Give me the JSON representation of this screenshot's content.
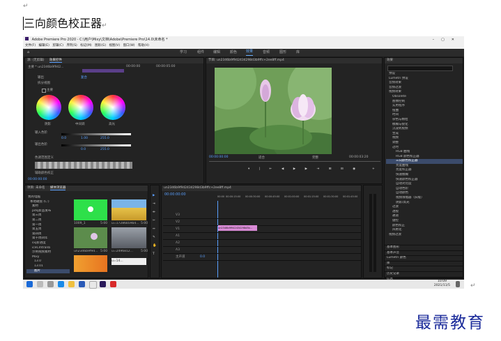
{
  "doc": {
    "title": "三向颜色校正器",
    "return_mark": "↵"
  },
  "app": {
    "window_title": "Adobe Premiere Pro 2020 - C:\\用户\\Mixy\\文档\\Adobe\\Premiere Pro\\14.0\\未命名 *",
    "menus": [
      "文件(F)",
      "编辑(E)",
      "剪辑(C)",
      "序列(S)",
      "标记(M)",
      "图形(G)",
      "视图(V)",
      "窗口(W)",
      "帮助(H)"
    ],
    "workspaces": [
      "学习",
      "组件",
      "编辑",
      "颜色",
      "效果",
      "音频",
      "图形",
      "库"
    ],
    "active_workspace": "效果",
    "window_controls": [
      "–",
      "▢",
      "✕"
    ]
  },
  "effect_controls": {
    "tabs": [
      "源: (无剪辑)",
      "效果控件"
    ],
    "clip": "主要 * un2346b9f942...",
    "time_start": "00:00:00",
    "time_end": "00:00:05:00",
    "output_label": "输出",
    "output_value": "复合",
    "bypass_label": "拆分视图",
    "master_label": "主要",
    "wheels": [
      {
        "label": "阴影"
      },
      {
        "label": "中间调"
      },
      {
        "label": "高光"
      }
    ],
    "input_levels_label": "输入色阶",
    "input_levels_values": [
      "0.0",
      "1.00",
      "255.0"
    ],
    "output_levels_label": "输出色阶",
    "output_levels_values": [
      "0.0",
      "255.0"
    ],
    "tonal_range_label": "色调范围定义",
    "secondary_label": "辅助颜色校正",
    "timecode": "00:00:00:00"
  },
  "program": {
    "title": "节目: un2346b9f942434298d3b9ffc+2ee8ff.mp4",
    "timecode_left": "00:00:00:00",
    "fit": "适合",
    "quality": "完整",
    "timecode_right": "00:00:03:20"
  },
  "project": {
    "tabs": [
      "项目: 未命名",
      "媒体浏览器"
    ],
    "tree": [
      "我的电脑",
      "本地磁盘 (C:)",
      "素材",
      "pdsj新品发布",
      "第三周",
      "第二周",
      "第一周",
      "第五周",
      "第四周",
      "第十周四年",
      "sxj新进度",
      "iceCmtranb",
      "示例视频素材",
      "Mixy",
      "13.0",
      "13.01",
      "图片"
    ],
    "thumbs": [
      {
        "name": "1009_1",
        "dur": "5:00"
      },
      {
        "name": "u=17286b59b4...",
        "dur": "5:00"
      },
      {
        "name": "un2346b9f94...",
        "dur": "5:00"
      },
      {
        "name": "u=2496812...",
        "dur": "5:00"
      },
      {
        "name": "u=14...",
        "dur": ""
      }
    ]
  },
  "timeline": {
    "title": "un2346b9f942434298d3b9ffc+2ee8ff.mp4",
    "timecode": "00:00:00:00",
    "ruler": [
      "00:00",
      "00:00:15:00",
      "00:00:30:00",
      "00:00:45:00",
      "00:01:00:00",
      "00:01:15:00",
      "00:01:30:00",
      "00:01:45:00"
    ],
    "tracks": [
      "V3",
      "V2",
      "V1",
      "A1",
      "A2",
      "A3",
      "主声道"
    ],
    "master_value": "0.0",
    "clip_label": "un2346b9f942434298d3b..."
  },
  "effects": {
    "title": "效果",
    "tree": [
      "预设",
      "Lumetri 预设",
      "音频效果",
      "音频过渡",
      "视频效果",
      "Obsolete",
      "图像控制",
      "实用程序",
      "扭曲",
      "时间",
      "杂色与颗粒",
      "模糊与锐化",
      "沉浸式视频",
      "生成",
      "视频",
      "调整",
      "过时",
      "RGB 曲线",
      "RGB 颜色校正器",
      "三向颜色校正器",
      "亮度曲线",
      "亮度校正器",
      "快速模糊",
      "快速颜色校正器",
      "自动对比度",
      "自动色阶",
      "自动颜色",
      "视频限幅器（旧版）",
      "阴影/高光",
      "过渡",
      "透视",
      "通道",
      "键控",
      "颜色校正",
      "风格化",
      "视频过渡"
    ],
    "selected": "三向颜色校正器",
    "footer": [
      "基本图形",
      "基本声音",
      "Lumetri 颜色",
      "库",
      "标记",
      "历史记录",
      "信息"
    ]
  },
  "taskbar": {
    "time": "10:09",
    "date": "2021/11/5"
  },
  "brand": "最需教育"
}
